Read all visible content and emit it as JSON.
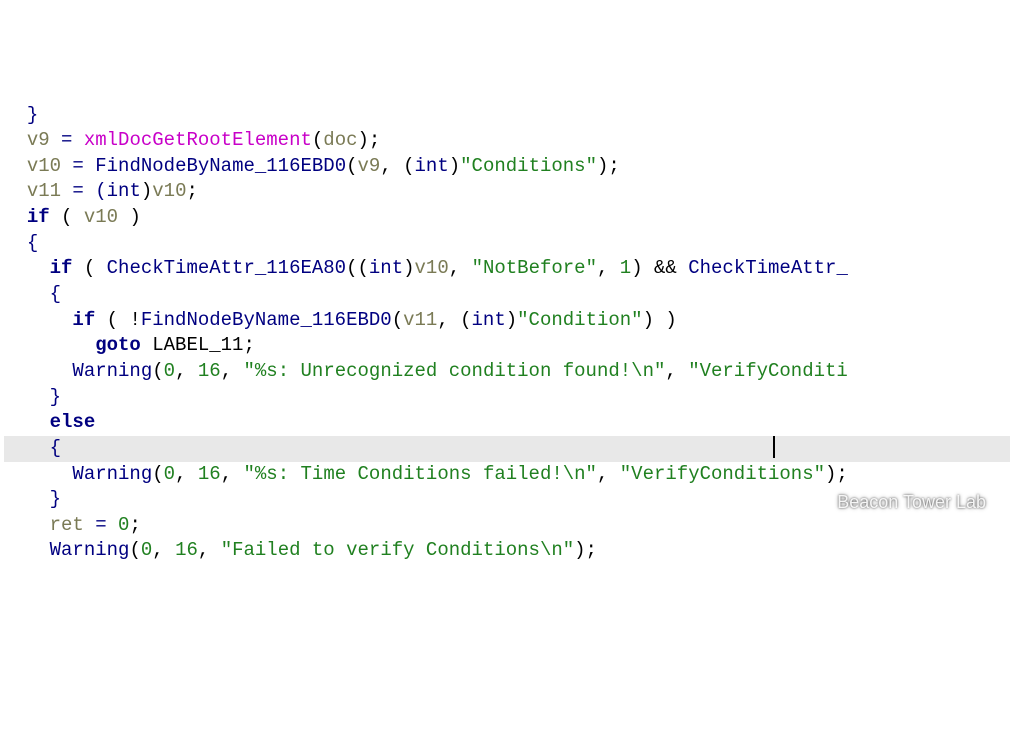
{
  "code": {
    "lines": [
      {
        "indent": 2,
        "highlight": false,
        "tokens": [
          {
            "t": "}",
            "c": "t-brace"
          }
        ]
      },
      {
        "indent": 2,
        "highlight": false,
        "tokens": [
          {
            "t": "v9",
            "c": "t-var"
          },
          {
            "t": " = ",
            "c": "t-op"
          },
          {
            "t": "xmlDocGetRootElement",
            "c": "t-func"
          },
          {
            "t": "(",
            "c": "t-paren"
          },
          {
            "t": "doc",
            "c": "t-var"
          },
          {
            "t": ");",
            "c": "t-paren"
          }
        ]
      },
      {
        "indent": 2,
        "highlight": false,
        "tokens": [
          {
            "t": "v10",
            "c": "t-var"
          },
          {
            "t": " = ",
            "c": "t-op"
          },
          {
            "t": "FindNodeByName_116EBD0",
            "c": "t-call"
          },
          {
            "t": "(",
            "c": "t-paren"
          },
          {
            "t": "v9",
            "c": "t-var"
          },
          {
            "t": ", (",
            "c": "t-sep"
          },
          {
            "t": "int",
            "c": "t-type"
          },
          {
            "t": ")",
            "c": "t-paren"
          },
          {
            "t": "\"Conditions\"",
            "c": "t-str"
          },
          {
            "t": ");",
            "c": "t-paren"
          }
        ]
      },
      {
        "indent": 2,
        "highlight": false,
        "tokens": [
          {
            "t": "v11",
            "c": "t-var"
          },
          {
            "t": " = (",
            "c": "t-op"
          },
          {
            "t": "int",
            "c": "t-type"
          },
          {
            "t": ")",
            "c": "t-paren"
          },
          {
            "t": "v10",
            "c": "t-var"
          },
          {
            "t": ";",
            "c": "t-sep"
          }
        ]
      },
      {
        "indent": 2,
        "highlight": false,
        "tokens": [
          {
            "t": "if",
            "c": "t-kw"
          },
          {
            "t": " ( ",
            "c": "t-paren"
          },
          {
            "t": "v10",
            "c": "t-var"
          },
          {
            "t": " )",
            "c": "t-paren"
          }
        ]
      },
      {
        "indent": 2,
        "highlight": false,
        "tokens": [
          {
            "t": "{",
            "c": "t-brace"
          }
        ]
      },
      {
        "indent": 4,
        "highlight": false,
        "tokens": [
          {
            "t": "if",
            "c": "t-kw"
          },
          {
            "t": " ( ",
            "c": "t-paren"
          },
          {
            "t": "CheckTimeAttr_116EA80",
            "c": "t-call"
          },
          {
            "t": "((",
            "c": "t-paren"
          },
          {
            "t": "int",
            "c": "t-type"
          },
          {
            "t": ")",
            "c": "t-paren"
          },
          {
            "t": "v10",
            "c": "t-var"
          },
          {
            "t": ", ",
            "c": "t-sep"
          },
          {
            "t": "\"NotBefore\"",
            "c": "t-str"
          },
          {
            "t": ", ",
            "c": "t-sep"
          },
          {
            "t": "1",
            "c": "t-num"
          },
          {
            "t": ") && ",
            "c": "t-paren"
          },
          {
            "t": "CheckTimeAttr_",
            "c": "t-call"
          }
        ]
      },
      {
        "indent": 4,
        "highlight": false,
        "tokens": [
          {
            "t": "{",
            "c": "t-brace"
          }
        ]
      },
      {
        "indent": 6,
        "highlight": false,
        "tokens": [
          {
            "t": "if",
            "c": "t-kw"
          },
          {
            "t": " ( !",
            "c": "t-paren"
          },
          {
            "t": "FindNodeByName_116EBD0",
            "c": "t-call"
          },
          {
            "t": "(",
            "c": "t-paren"
          },
          {
            "t": "v11",
            "c": "t-var"
          },
          {
            "t": ", (",
            "c": "t-sep"
          },
          {
            "t": "int",
            "c": "t-type"
          },
          {
            "t": ")",
            "c": "t-paren"
          },
          {
            "t": "\"Condition\"",
            "c": "t-str"
          },
          {
            "t": ") )",
            "c": "t-paren"
          }
        ]
      },
      {
        "indent": 8,
        "highlight": false,
        "tokens": [
          {
            "t": "goto",
            "c": "t-kw"
          },
          {
            "t": " ",
            "c": "t-plain"
          },
          {
            "t": "LABEL_11",
            "c": "t-plain"
          },
          {
            "t": ";",
            "c": "t-sep"
          }
        ]
      },
      {
        "indent": 6,
        "highlight": false,
        "tokens": [
          {
            "t": "Warning",
            "c": "t-call"
          },
          {
            "t": "(",
            "c": "t-paren"
          },
          {
            "t": "0",
            "c": "t-num"
          },
          {
            "t": ", ",
            "c": "t-sep"
          },
          {
            "t": "16",
            "c": "t-num"
          },
          {
            "t": ", ",
            "c": "t-sep"
          },
          {
            "t": "\"%s: Unrecognized condition found!\\n\"",
            "c": "t-str"
          },
          {
            "t": ", ",
            "c": "t-sep"
          },
          {
            "t": "\"VerifyConditi",
            "c": "t-str"
          }
        ]
      },
      {
        "indent": 4,
        "highlight": false,
        "tokens": [
          {
            "t": "}",
            "c": "t-brace"
          }
        ]
      },
      {
        "indent": 4,
        "highlight": false,
        "tokens": [
          {
            "t": "else",
            "c": "t-kw"
          }
        ]
      },
      {
        "indent": 4,
        "highlight": true,
        "tokens": [
          {
            "t": "{",
            "c": "t-brace"
          }
        ]
      },
      {
        "indent": 6,
        "highlight": false,
        "tokens": [
          {
            "t": "Warning",
            "c": "t-call"
          },
          {
            "t": "(",
            "c": "t-paren"
          },
          {
            "t": "0",
            "c": "t-num"
          },
          {
            "t": ", ",
            "c": "t-sep"
          },
          {
            "t": "16",
            "c": "t-num"
          },
          {
            "t": ", ",
            "c": "t-sep"
          },
          {
            "t": "\"%s: Time Conditions failed!\\n\"",
            "c": "t-str"
          },
          {
            "t": ", ",
            "c": "t-sep"
          },
          {
            "t": "\"VerifyConditions\"",
            "c": "t-str"
          },
          {
            "t": ");",
            "c": "t-paren"
          }
        ]
      },
      {
        "indent": 4,
        "highlight": false,
        "tokens": [
          {
            "t": "}",
            "c": "t-brace"
          }
        ]
      },
      {
        "indent": 4,
        "highlight": false,
        "tokens": [
          {
            "t": "ret",
            "c": "t-var"
          },
          {
            "t": " = ",
            "c": "t-op"
          },
          {
            "t": "0",
            "c": "t-num"
          },
          {
            "t": ";",
            "c": "t-sep"
          }
        ]
      },
      {
        "indent": 4,
        "highlight": false,
        "tokens": [
          {
            "t": "Warning",
            "c": "t-call"
          },
          {
            "t": "(",
            "c": "t-paren"
          },
          {
            "t": "0",
            "c": "t-num"
          },
          {
            "t": ", ",
            "c": "t-sep"
          },
          {
            "t": "16",
            "c": "t-num"
          },
          {
            "t": ", ",
            "c": "t-sep"
          },
          {
            "t": "\"Failed to verify Conditions\\n\"",
            "c": "t-str"
          },
          {
            "t": ");",
            "c": "t-paren"
          }
        ]
      }
    ]
  },
  "watermark": {
    "label": "Beacon Tower Lab"
  },
  "cursor_line": 13
}
